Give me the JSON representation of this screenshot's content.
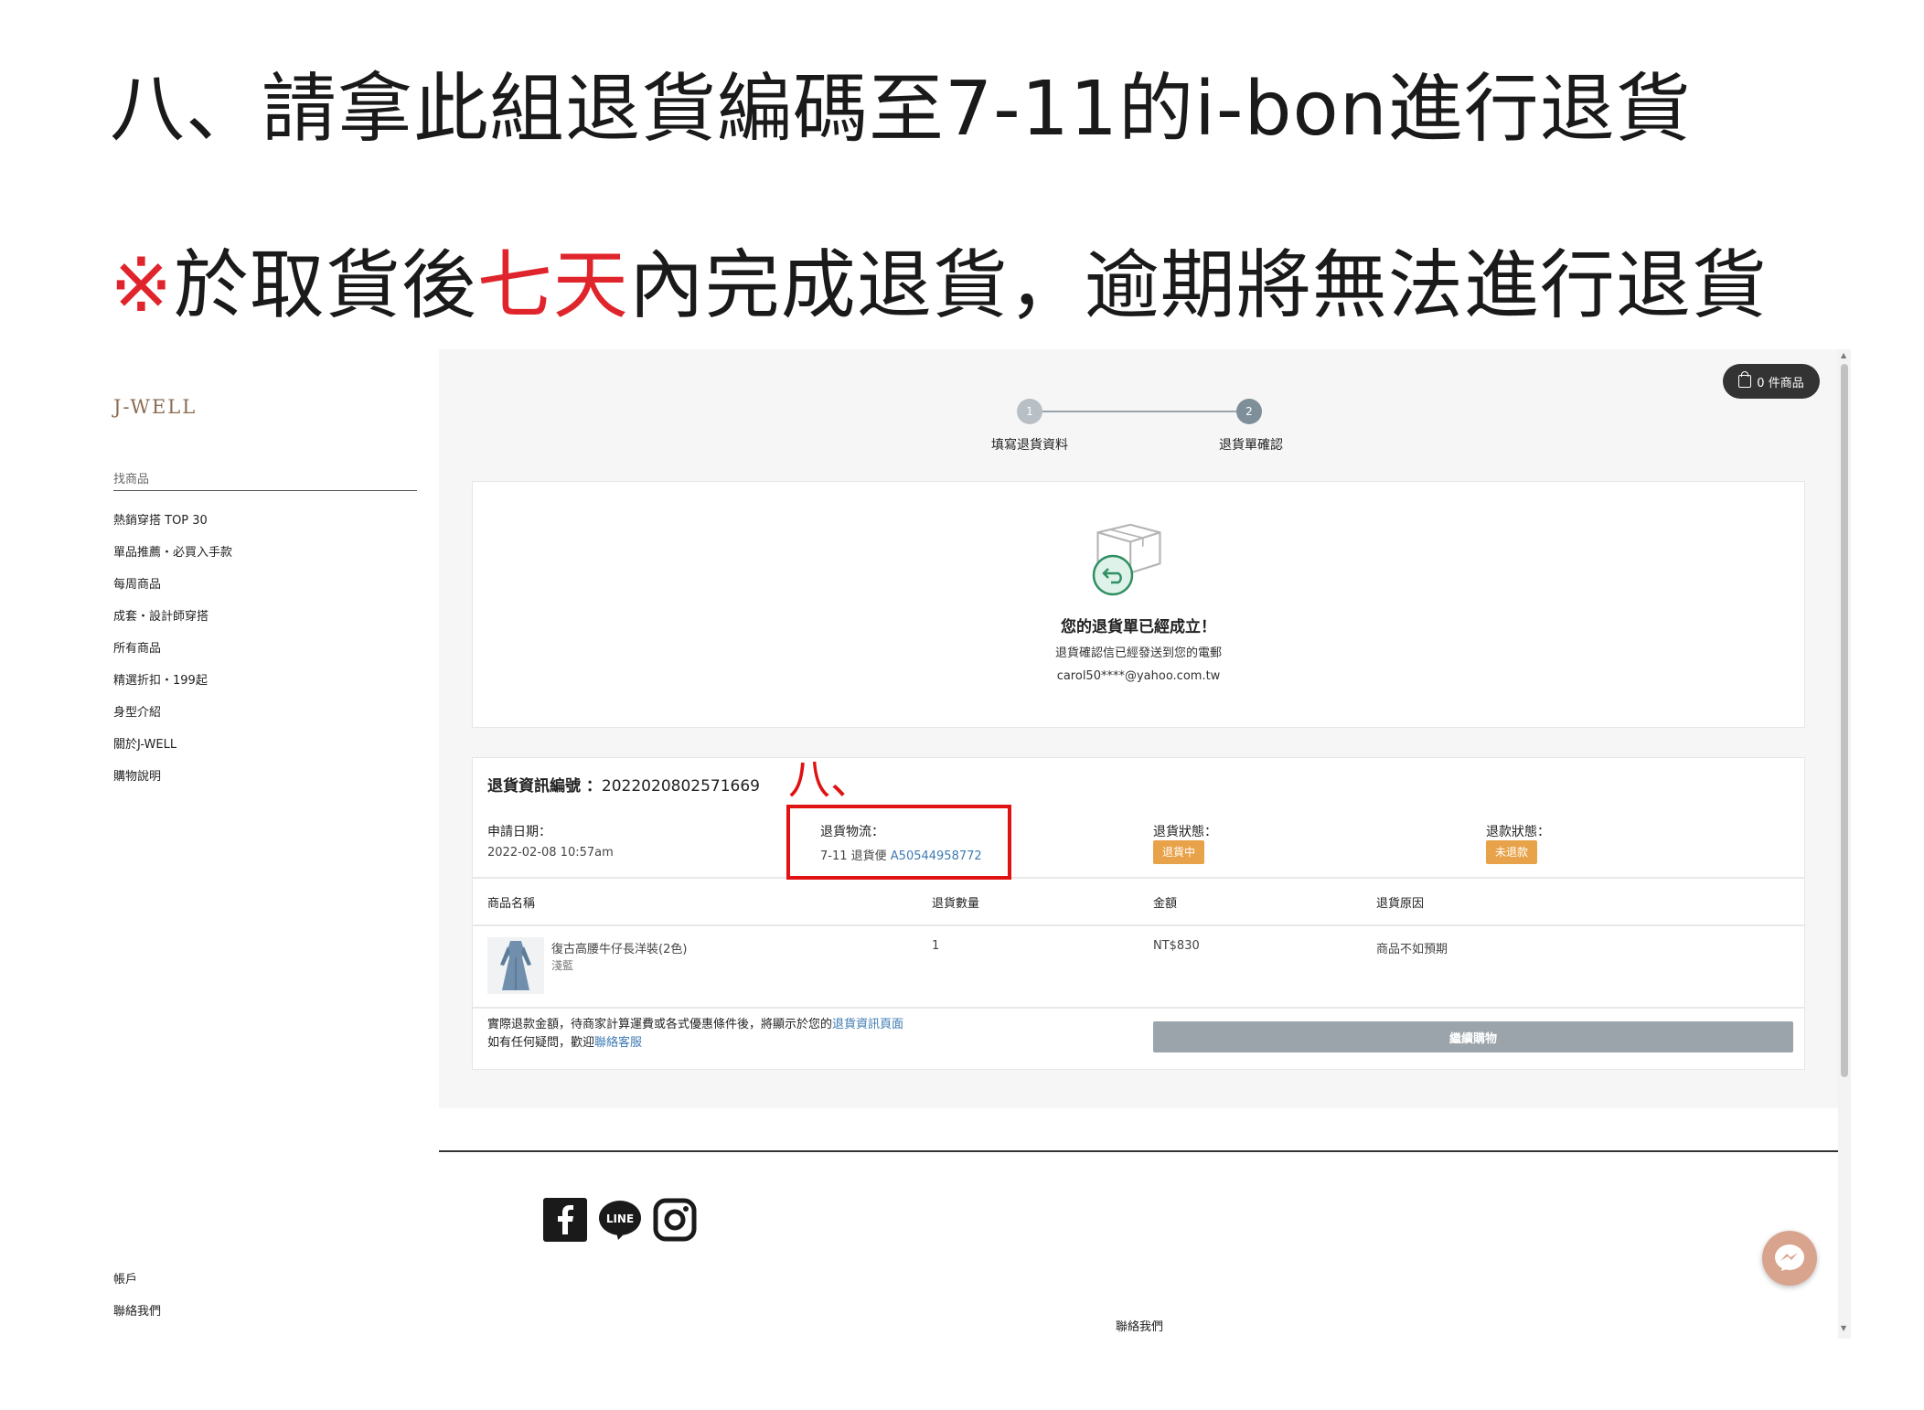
{
  "slide": {
    "title": "八、請拿此組退貨編碼至7-11的i-bon進行退貨",
    "note_mark": "※",
    "note_part1": "於取貨後",
    "note_highlight": "七天",
    "note_part2": "內完成退貨，逾期將無法進行退貨",
    "annotation_label": "八、"
  },
  "sidebar": {
    "brand": "J-WELL",
    "search_placeholder": "找商品",
    "nav": [
      "熱銷穿搭 TOP 30",
      "單品推薦・必買入手款",
      "每周商品",
      "成套・設計師穿搭",
      "所有商品",
      "精選折扣・199起",
      "身型介紹",
      "關於J-WELL",
      "購物說明"
    ],
    "footer_links": [
      "帳戶",
      "聯絡我們"
    ]
  },
  "header": {
    "cart_label": "0 件商品"
  },
  "steps": [
    {
      "number": "1",
      "label": "填寫退貨資料"
    },
    {
      "number": "2",
      "label": "退貨單確認"
    }
  ],
  "success": {
    "title": "您的退貨單已經成立！",
    "subtitle": "退貨確認信已經發送到您的電郵",
    "email": "carol50****@yahoo.com.tw"
  },
  "detail": {
    "heading_label": "退貨資訊編號 ：",
    "return_number": "2022020802571669",
    "apply_date_label": "申請日期：",
    "apply_date": "2022-02-08 10:57am",
    "logistics_label": "退貨物流：",
    "logistics_carrier": "7-11 退貨便",
    "logistics_code": "A50544958772",
    "status_label": "退貨狀態：",
    "status_value": "退貨中",
    "refund_label": "退款狀態：",
    "refund_value": "未退款",
    "columns": [
      "商品名稱",
      "退貨數量",
      "金額",
      "退貨原因"
    ],
    "item": {
      "name": "復古高腰牛仔長洋裝(2色)",
      "variant": "淺藍",
      "quantity": "1",
      "amount": "NT$830",
      "reason": "商品不如預期"
    },
    "footnote_1": "實際退款金額，待商家計算運費或各式優惠條件後，將顯示於您的",
    "footnote_1_link": "退貨資訊頁面",
    "footnote_2": "如有任何疑問，歡迎",
    "footnote_2_link": "聯絡客服",
    "continue_label": "繼續購物"
  },
  "footer": {
    "contact_label": "聯絡我們",
    "social": [
      "facebook-icon",
      "line-icon",
      "instagram-icon"
    ]
  },
  "colors": {
    "accent_red": "#e01212",
    "badge_orange": "#e8a34a",
    "link_blue": "#3e7ab3",
    "brand_brown": "#8b6b52"
  }
}
